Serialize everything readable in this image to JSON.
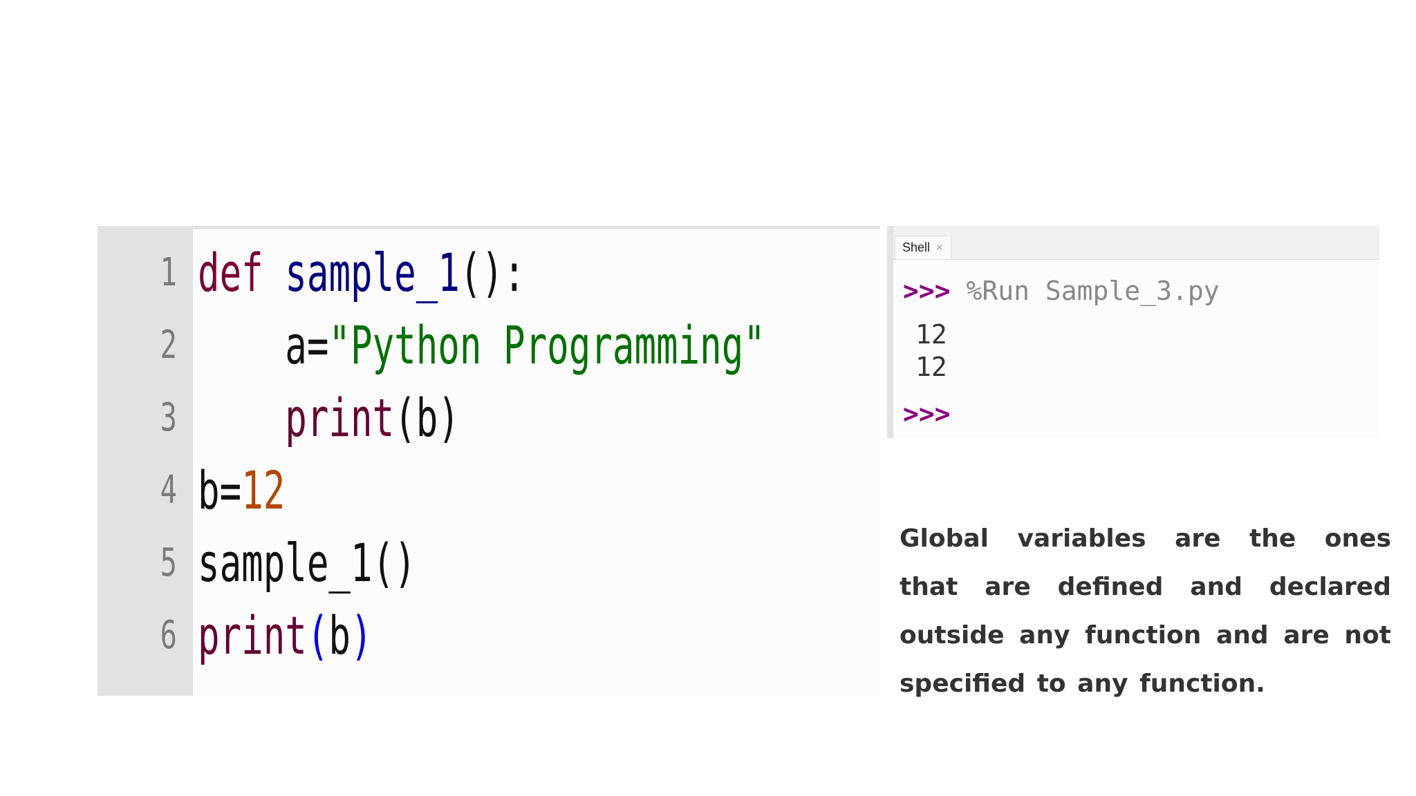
{
  "editor": {
    "lines": [
      {
        "number": "1",
        "tokens": [
          "def",
          " ",
          "sample_1",
          "():"
        ]
      },
      {
        "number": "2",
        "tokens": [
          "    a=",
          "\"Python Programming\""
        ]
      },
      {
        "number": "3",
        "tokens": [
          "    ",
          "print",
          "(b)"
        ]
      },
      {
        "number": "4",
        "tokens": [
          "b=",
          "12"
        ]
      },
      {
        "number": "5",
        "tokens": [
          "sample_1()"
        ]
      },
      {
        "number": "6",
        "tokens": [
          "print",
          "(",
          "b",
          ")"
        ]
      }
    ]
  },
  "shell": {
    "tab_label": "Shell",
    "close_icon": "close-icon",
    "prompt": ">>>",
    "command": "%Run Sample_3.py",
    "outputs": [
      "12",
      "12"
    ],
    "final_prompt": ">>>"
  },
  "description": {
    "text": "Global variables are the ones that are defined and declared outside any function and are not specified to any function."
  },
  "colors": {
    "keyword": "#7a0032",
    "function_name": "#000080",
    "string": "#007000",
    "number": "#b34700",
    "builtin": "#660033",
    "prompt": "#8b0082",
    "gutter": "#e2e2e2"
  }
}
